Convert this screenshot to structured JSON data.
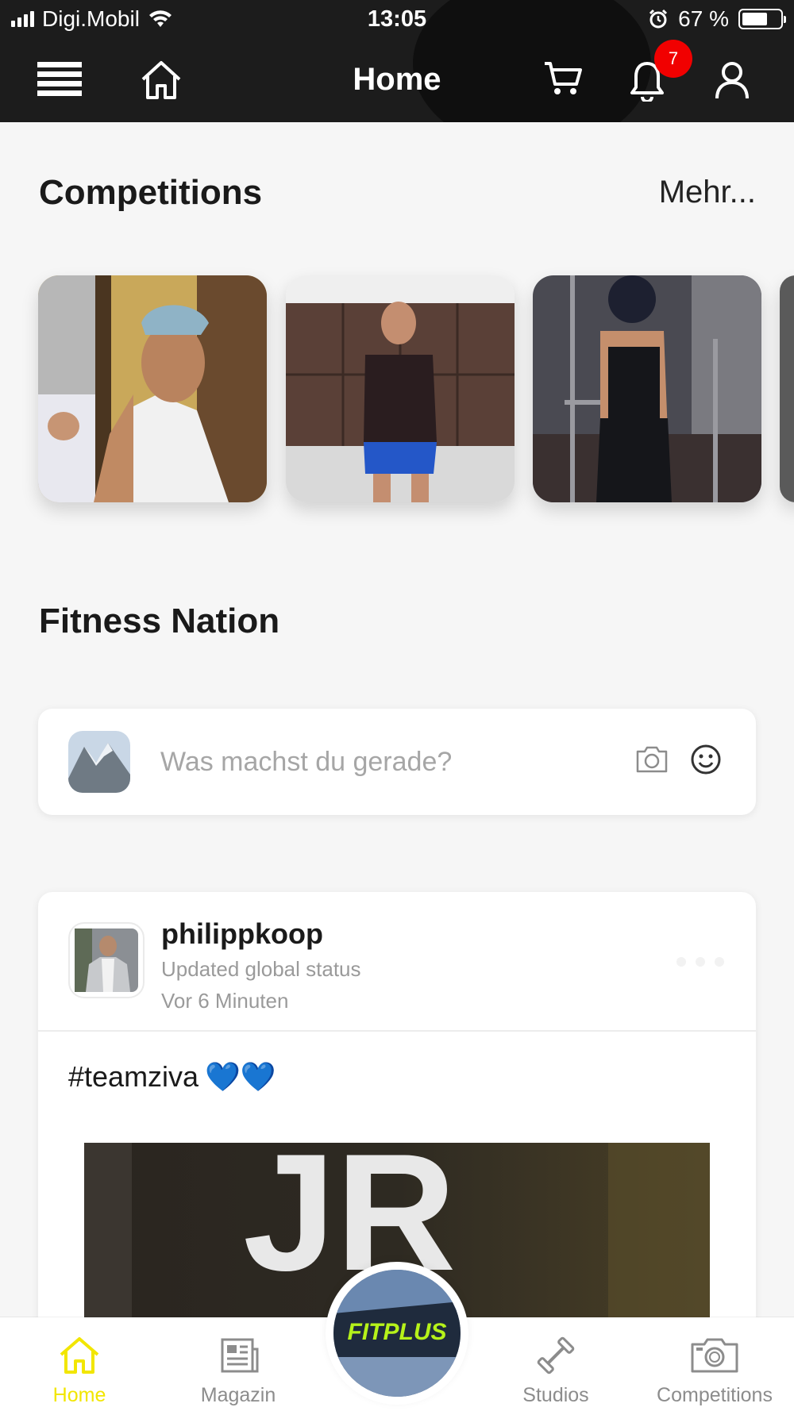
{
  "status_bar": {
    "carrier": "Digi.Mobil",
    "time": "13:05",
    "battery": "67 %",
    "battery_level": 0.67
  },
  "nav": {
    "title": "Home",
    "notification_count": "7",
    "icons": [
      "menu-icon",
      "home-icon",
      "cart-icon",
      "bell-icon",
      "user-icon"
    ]
  },
  "competitions": {
    "title": "Competitions",
    "more_label": "Mehr..."
  },
  "fitness_nation": {
    "title": "Fitness Nation"
  },
  "composer": {
    "placeholder": "Was machst du gerade?",
    "icons": [
      "camera-icon",
      "smiley-icon"
    ]
  },
  "post": {
    "username": "philippkoop",
    "status": "Updated global status",
    "time": "Vor 6 Minuten",
    "text": "#teamziva",
    "emoji": "💙💙",
    "image_text": "JR"
  },
  "tab_bar": {
    "home": "Home",
    "magazin": "Magazin",
    "center_logo": "FITPLUS",
    "studios": "Studios",
    "competitions": "Competitions"
  },
  "colors": {
    "header_bg": "#1c1c1c",
    "accent_yellow": "#f2e600",
    "badge_red": "#f10000",
    "heart_blue": "#1677ff"
  }
}
